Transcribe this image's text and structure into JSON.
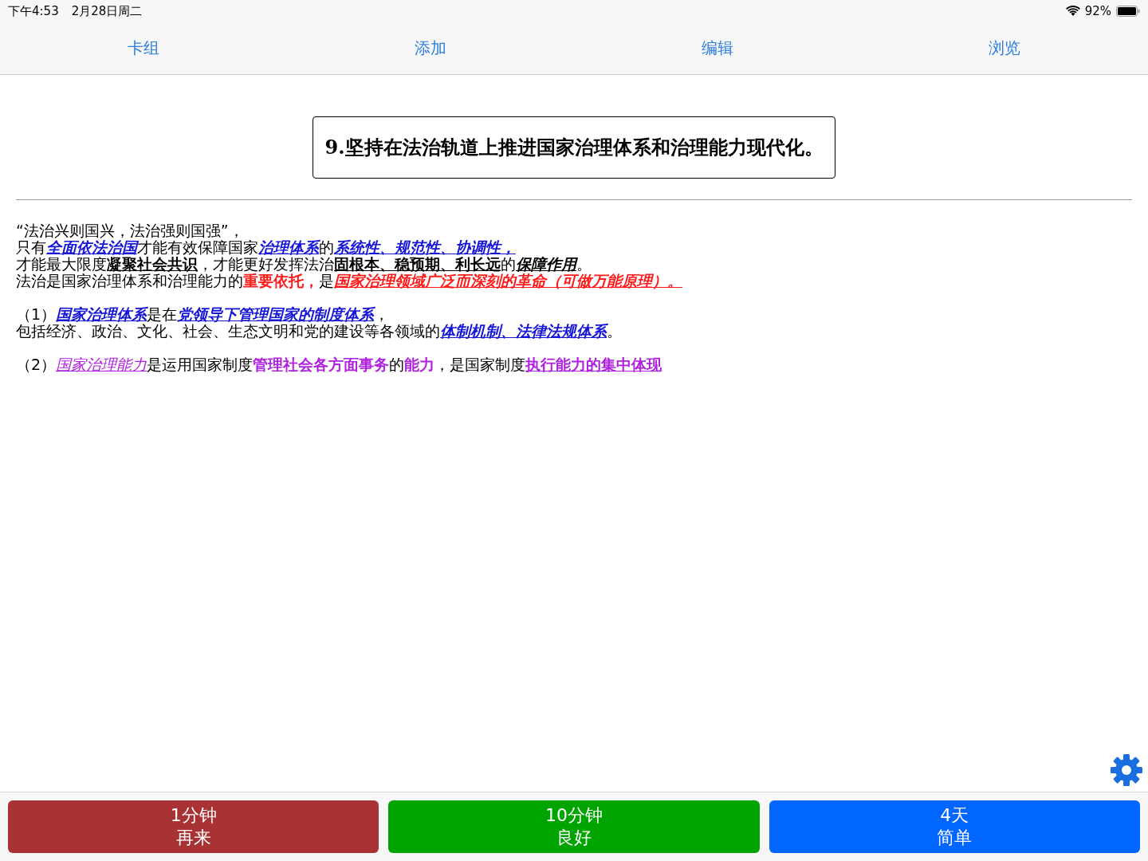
{
  "status_bar": {
    "time": "下午4:53",
    "date": "2月28日周二",
    "battery": "92%"
  },
  "tabs": [
    {
      "label": "卡组"
    },
    {
      "label": "添加"
    },
    {
      "label": "编辑"
    },
    {
      "label": "浏览"
    }
  ],
  "card": {
    "question": "9.坚持在法治轨道上推进国家治理体系和治理能力现代化。",
    "paragraphs": [
      {
        "lines": [
          [
            {
              "text": "“法治兴则国兴，法治强则国强”，",
              "kind": "plain"
            }
          ],
          [
            {
              "text": "只有",
              "kind": "plain"
            },
            {
              "text": "全面依法治国",
              "kind": "emph-blue"
            },
            {
              "text": "才能有效保障国家",
              "kind": "plain"
            },
            {
              "text": "治理体系",
              "kind": "emph-blue"
            },
            {
              "text": "的",
              "kind": "plain"
            },
            {
              "text": "系统性、规范性、协调性，",
              "kind": "emph-blue"
            }
          ],
          [
            {
              "text": "才能最大限度",
              "kind": "plain"
            },
            {
              "text": "凝聚社会共识",
              "kind": "key-black"
            },
            {
              "text": "，才能更好发挥法治",
              "kind": "plain"
            },
            {
              "text": "固根本、稳预期、利长远",
              "kind": "key-black"
            },
            {
              "text": "的",
              "kind": "plain"
            },
            {
              "text": "保障作用",
              "kind": "emph-black"
            },
            {
              "text": "。",
              "kind": "plain"
            }
          ],
          [
            {
              "text": "法治是国家治理体系和治理能力的",
              "kind": "plain"
            },
            {
              "text": "重要依托，",
              "kind": "strong-red"
            },
            {
              "text": "是",
              "kind": "plain"
            },
            {
              "text": "国家治理领域广泛而深刻的革命（可做万能原理）。",
              "kind": "emph-red"
            }
          ]
        ]
      },
      {
        "lines": [
          [
            {
              "text": "（1）",
              "kind": "plain"
            },
            {
              "text": "国家治理体系",
              "kind": "emph-blue"
            },
            {
              "text": "是在",
              "kind": "plain"
            },
            {
              "text": "党领导下管理国家的制度体系",
              "kind": "emph-blue"
            },
            {
              "text": "，",
              "kind": "plain"
            }
          ],
          [
            {
              "text": "包括经济、政治、文化、社会、生态文明和党的建设等各领域的",
              "kind": "plain"
            },
            {
              "text": "体制机制、法律法规体系",
              "kind": "emph-blue"
            },
            {
              "text": "。",
              "kind": "plain"
            }
          ]
        ]
      },
      {
        "lines": [
          [
            {
              "text": "（2）",
              "kind": "plain"
            },
            {
              "text": "国家治理能力",
              "kind": "emph-purple"
            },
            {
              "text": "是运用国家制度",
              "kind": "plain"
            },
            {
              "text": "管理社会各方面事务",
              "kind": "strong-purple"
            },
            {
              "text": "的",
              "kind": "plain"
            },
            {
              "text": "能力",
              "kind": "strong-purple"
            },
            {
              "text": "，是国家制度",
              "kind": "plain"
            },
            {
              "text": "执行能力的集中体现",
              "kind": "link-purple"
            }
          ]
        ]
      }
    ]
  },
  "answer_buttons": [
    {
      "interval": "1分钟",
      "label": "再来",
      "color": "#a83234"
    },
    {
      "interval": "10分钟",
      "label": "良好",
      "color": "#00a400"
    },
    {
      "interval": "4天",
      "label": "简单",
      "color": "#0066ff"
    }
  ]
}
